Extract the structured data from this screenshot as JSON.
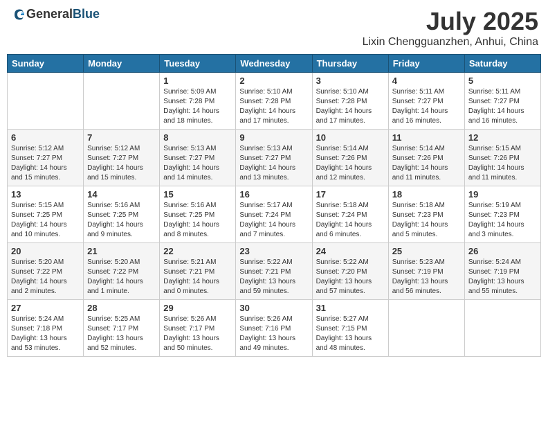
{
  "logo": {
    "text1": "General",
    "text2": "Blue"
  },
  "title": "July 2025",
  "location": "Lixin Chengguanzhen, Anhui, China",
  "weekdays": [
    "Sunday",
    "Monday",
    "Tuesday",
    "Wednesday",
    "Thursday",
    "Friday",
    "Saturday"
  ],
  "weeks": [
    [
      {
        "day": "",
        "info": ""
      },
      {
        "day": "",
        "info": ""
      },
      {
        "day": "1",
        "info": "Sunrise: 5:09 AM\nSunset: 7:28 PM\nDaylight: 14 hours\nand 18 minutes."
      },
      {
        "day": "2",
        "info": "Sunrise: 5:10 AM\nSunset: 7:28 PM\nDaylight: 14 hours\nand 17 minutes."
      },
      {
        "day": "3",
        "info": "Sunrise: 5:10 AM\nSunset: 7:28 PM\nDaylight: 14 hours\nand 17 minutes."
      },
      {
        "day": "4",
        "info": "Sunrise: 5:11 AM\nSunset: 7:27 PM\nDaylight: 14 hours\nand 16 minutes."
      },
      {
        "day": "5",
        "info": "Sunrise: 5:11 AM\nSunset: 7:27 PM\nDaylight: 14 hours\nand 16 minutes."
      }
    ],
    [
      {
        "day": "6",
        "info": "Sunrise: 5:12 AM\nSunset: 7:27 PM\nDaylight: 14 hours\nand 15 minutes."
      },
      {
        "day": "7",
        "info": "Sunrise: 5:12 AM\nSunset: 7:27 PM\nDaylight: 14 hours\nand 15 minutes."
      },
      {
        "day": "8",
        "info": "Sunrise: 5:13 AM\nSunset: 7:27 PM\nDaylight: 14 hours\nand 14 minutes."
      },
      {
        "day": "9",
        "info": "Sunrise: 5:13 AM\nSunset: 7:27 PM\nDaylight: 14 hours\nand 13 minutes."
      },
      {
        "day": "10",
        "info": "Sunrise: 5:14 AM\nSunset: 7:26 PM\nDaylight: 14 hours\nand 12 minutes."
      },
      {
        "day": "11",
        "info": "Sunrise: 5:14 AM\nSunset: 7:26 PM\nDaylight: 14 hours\nand 11 minutes."
      },
      {
        "day": "12",
        "info": "Sunrise: 5:15 AM\nSunset: 7:26 PM\nDaylight: 14 hours\nand 11 minutes."
      }
    ],
    [
      {
        "day": "13",
        "info": "Sunrise: 5:15 AM\nSunset: 7:25 PM\nDaylight: 14 hours\nand 10 minutes."
      },
      {
        "day": "14",
        "info": "Sunrise: 5:16 AM\nSunset: 7:25 PM\nDaylight: 14 hours\nand 9 minutes."
      },
      {
        "day": "15",
        "info": "Sunrise: 5:16 AM\nSunset: 7:25 PM\nDaylight: 14 hours\nand 8 minutes."
      },
      {
        "day": "16",
        "info": "Sunrise: 5:17 AM\nSunset: 7:24 PM\nDaylight: 14 hours\nand 7 minutes."
      },
      {
        "day": "17",
        "info": "Sunrise: 5:18 AM\nSunset: 7:24 PM\nDaylight: 14 hours\nand 6 minutes."
      },
      {
        "day": "18",
        "info": "Sunrise: 5:18 AM\nSunset: 7:23 PM\nDaylight: 14 hours\nand 5 minutes."
      },
      {
        "day": "19",
        "info": "Sunrise: 5:19 AM\nSunset: 7:23 PM\nDaylight: 14 hours\nand 3 minutes."
      }
    ],
    [
      {
        "day": "20",
        "info": "Sunrise: 5:20 AM\nSunset: 7:22 PM\nDaylight: 14 hours\nand 2 minutes."
      },
      {
        "day": "21",
        "info": "Sunrise: 5:20 AM\nSunset: 7:22 PM\nDaylight: 14 hours\nand 1 minute."
      },
      {
        "day": "22",
        "info": "Sunrise: 5:21 AM\nSunset: 7:21 PM\nDaylight: 14 hours\nand 0 minutes."
      },
      {
        "day": "23",
        "info": "Sunrise: 5:22 AM\nSunset: 7:21 PM\nDaylight: 13 hours\nand 59 minutes."
      },
      {
        "day": "24",
        "info": "Sunrise: 5:22 AM\nSunset: 7:20 PM\nDaylight: 13 hours\nand 57 minutes."
      },
      {
        "day": "25",
        "info": "Sunrise: 5:23 AM\nSunset: 7:19 PM\nDaylight: 13 hours\nand 56 minutes."
      },
      {
        "day": "26",
        "info": "Sunrise: 5:24 AM\nSunset: 7:19 PM\nDaylight: 13 hours\nand 55 minutes."
      }
    ],
    [
      {
        "day": "27",
        "info": "Sunrise: 5:24 AM\nSunset: 7:18 PM\nDaylight: 13 hours\nand 53 minutes."
      },
      {
        "day": "28",
        "info": "Sunrise: 5:25 AM\nSunset: 7:17 PM\nDaylight: 13 hours\nand 52 minutes."
      },
      {
        "day": "29",
        "info": "Sunrise: 5:26 AM\nSunset: 7:17 PM\nDaylight: 13 hours\nand 50 minutes."
      },
      {
        "day": "30",
        "info": "Sunrise: 5:26 AM\nSunset: 7:16 PM\nDaylight: 13 hours\nand 49 minutes."
      },
      {
        "day": "31",
        "info": "Sunrise: 5:27 AM\nSunset: 7:15 PM\nDaylight: 13 hours\nand 48 minutes."
      },
      {
        "day": "",
        "info": ""
      },
      {
        "day": "",
        "info": ""
      }
    ]
  ]
}
